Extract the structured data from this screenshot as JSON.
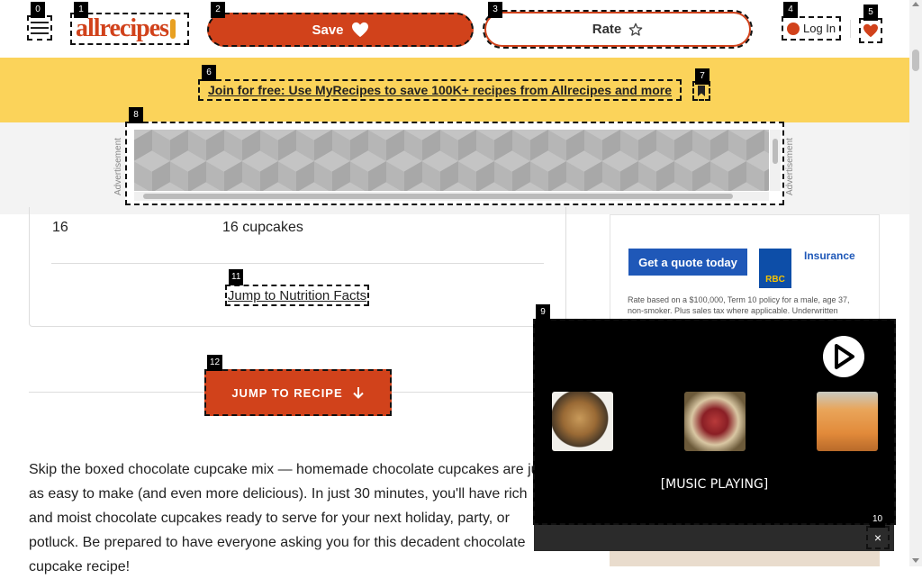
{
  "header": {
    "logo_text": "allrecipes",
    "save_label": "Save",
    "rate_label": "Rate",
    "login_label": "Log In"
  },
  "promo": {
    "text": "Join for free: Use MyRecipes to save 100K+ recipes from Allrecipes and more"
  },
  "ad_band": {
    "label_left": "Advertisement",
    "label_right": "Advertisement"
  },
  "nutrition_card": {
    "servings": "16",
    "yield": "16 cupcakes",
    "nutrition_link": "Jump to Nutrition Facts"
  },
  "jump_button": "JUMP TO RECIPE",
  "intro_text": "Skip the boxed chocolate cupcake mix — homemade chocolate cupcakes are just as easy to make (and even more delicious). In just 30 minutes, you'll have rich and moist chocolate cupcakes ready to serve for your next holiday, party, or potluck. Be prepared to have everyone asking you for this decadent chocolate cupcake recipe!",
  "side_ad": {
    "cta": "Get a quote today",
    "brand": "RBC",
    "product": "Insurance",
    "fine_print": "Rate based on a $100,000, Term 10 policy for a male, age 37, non-smoker. Plus sales tax where applicable. Underwritten"
  },
  "video_player": {
    "caption": "[MUSIC PLAYING]",
    "close_symbol": "×"
  },
  "markers": [
    "0",
    "1",
    "2",
    "3",
    "4",
    "5",
    "6",
    "7",
    "8",
    "9",
    "10",
    "11",
    "12"
  ],
  "colors": {
    "brand": "#d1421b",
    "promo_bg": "#fbd35a",
    "rbc_blue": "#1f58b8"
  }
}
